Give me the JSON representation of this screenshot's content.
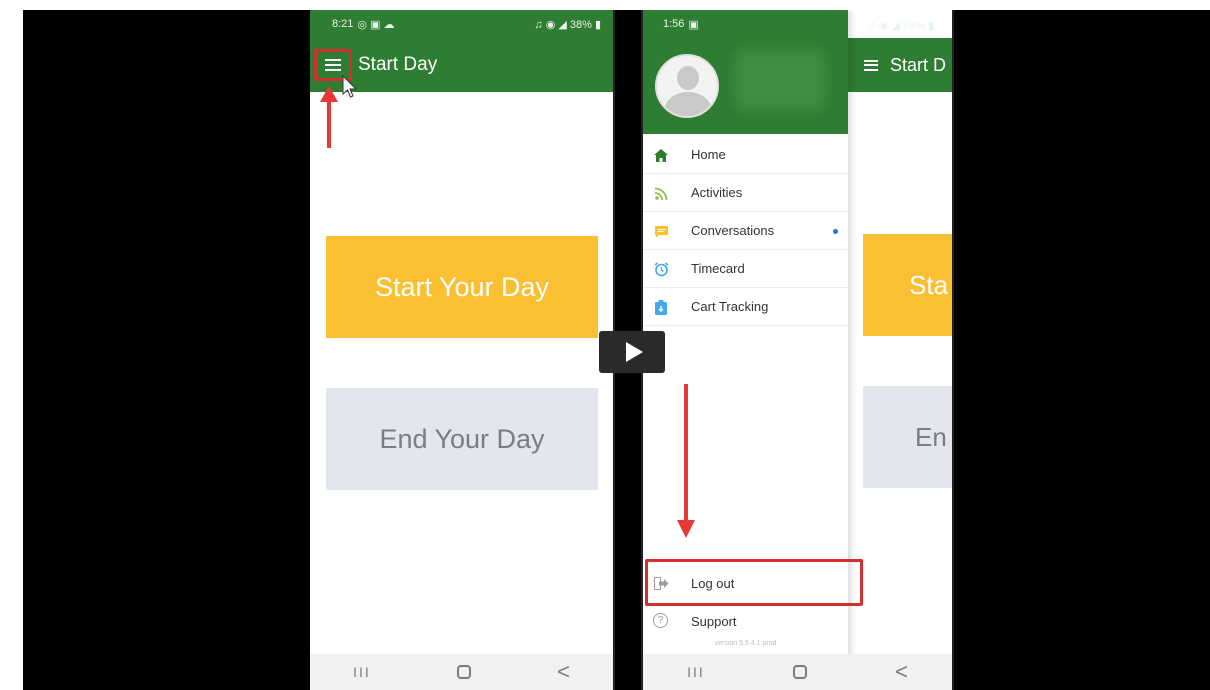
{
  "left_phone": {
    "status": {
      "time": "8:21",
      "left_icons": "◎ ▣ ☁",
      "right_icons": "♫ ◉ ◢ 38% ▮"
    },
    "appbar": {
      "title": "Start Day"
    },
    "buttons": {
      "start": "Start Your Day",
      "end": "End Your Day"
    }
  },
  "right_phone": {
    "status": {
      "time": "1:56",
      "left_icon": "▣",
      "right_icons": "♫ ◉ ◢ 74% ▮"
    },
    "appbar_title_partial": "Start D",
    "bg_buttons": {
      "start_partial": "Sta",
      "end_partial": "En"
    },
    "drawer": {
      "items": [
        {
          "label": "Home",
          "icon": "home-icon",
          "color": "#2e7d32"
        },
        {
          "label": "Activities",
          "icon": "rss-icon",
          "color": "#8bc34a"
        },
        {
          "label": "Conversations",
          "icon": "chat-icon",
          "color": "#fbc02d",
          "badge": true
        },
        {
          "label": "Timecard",
          "icon": "alarm-clock-icon",
          "color": "#42a5f5"
        },
        {
          "label": "Cart Tracking",
          "icon": "cart-tracking-icon",
          "color": "#42a5f5"
        }
      ],
      "logout": "Log out",
      "support": "Support",
      "version": "version 5.5.4.1 prod"
    }
  },
  "nav_bar": {
    "recent": "III",
    "back": "<"
  },
  "colors": {
    "green": "#2e7d32",
    "yellow": "#fbbf33",
    "gray": "#e3e6ec",
    "highlight": "#d32f2f"
  },
  "video": {
    "control": "play-icon"
  }
}
